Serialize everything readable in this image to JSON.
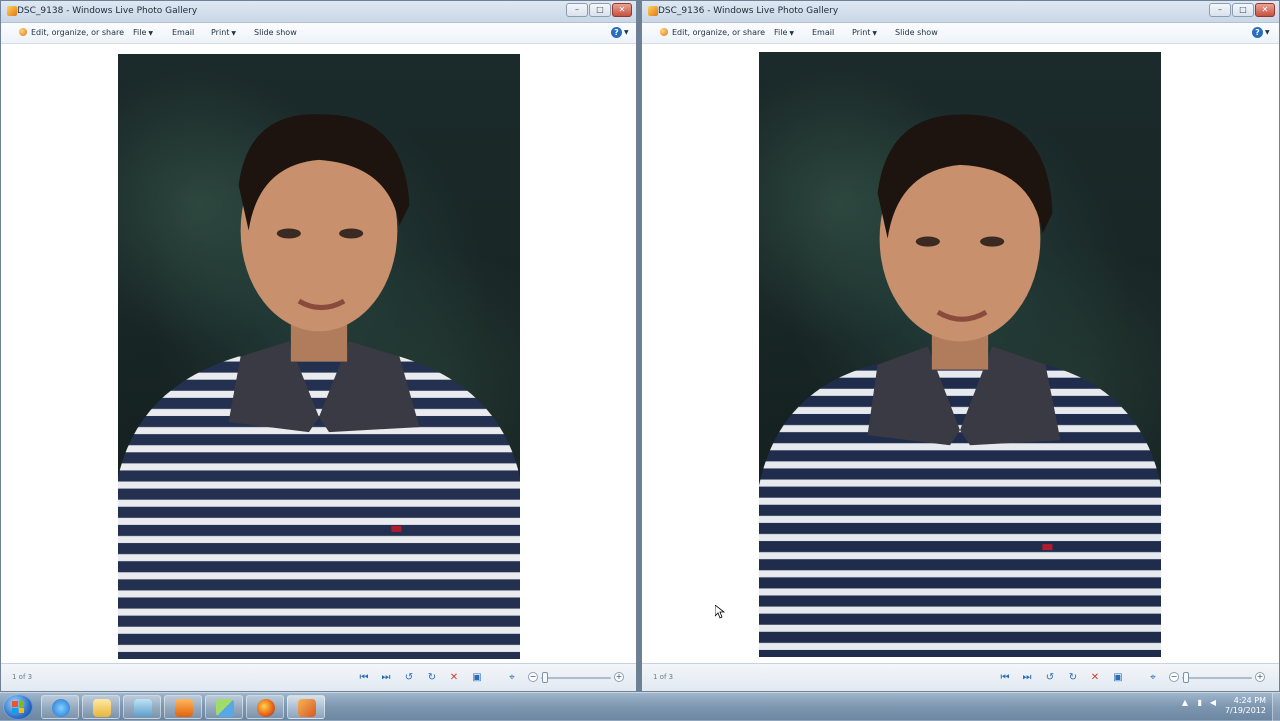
{
  "windows": [
    {
      "title": "DSC_9138 - Windows Live Photo Gallery",
      "toolbar": {
        "edit": "Edit, organize, or share",
        "file": "File",
        "email": "Email",
        "print": "Print",
        "slideshow": "Slide show",
        "help": "?"
      },
      "counter": "1 of 3"
    },
    {
      "title": "DSC_9136 - Windows Live Photo Gallery",
      "toolbar": {
        "edit": "Edit, organize, or share",
        "file": "File",
        "email": "Email",
        "print": "Print",
        "slideshow": "Slide show",
        "help": "?"
      },
      "counter": "1 of 3"
    }
  ],
  "window_buttons": {
    "minimize": "–",
    "maximize": "□",
    "close": "✕"
  },
  "statusbar_icons": {
    "first": "⏮",
    "next": "⏭",
    "rotate_left": "↺",
    "rotate_right": "↻",
    "delete": "✕",
    "slideshow": "▣",
    "fit": "⌖",
    "zoom_out": "−",
    "zoom_in": "+"
  },
  "taskbar": {
    "apps": [
      "internet-explorer",
      "windows-explorer",
      "windows-live-messenger",
      "media-player",
      "photo-gallery",
      "firefox",
      "tool-app"
    ],
    "clock_time": "4:24 PM",
    "clock_date": "7/19/2012"
  },
  "colors": {
    "accent": "#2b6cb5",
    "delete": "#d3392b",
    "taskbar": "#7d97b1"
  }
}
